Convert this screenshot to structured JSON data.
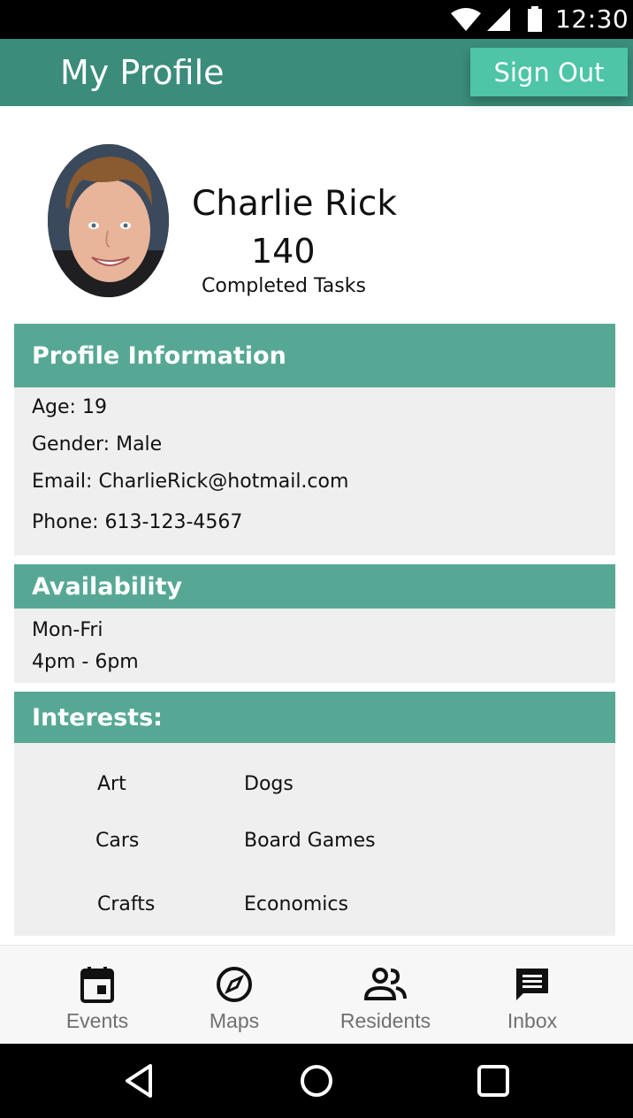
{
  "status_bar": {
    "time": "12:30",
    "icons": [
      "wifi-icon",
      "signal-icon",
      "battery-icon"
    ]
  },
  "header": {
    "title": "My Profile",
    "sign_out_label": "Sign Out"
  },
  "profile": {
    "name": "Charlie Rick",
    "completed_count": "140",
    "completed_label": "Completed Tasks"
  },
  "profile_info": {
    "title": "Profile Information",
    "age": "Age: 19",
    "gender": "Gender: Male",
    "email": "Email: CharlieRick@hotmail.com",
    "phone": "Phone: 613-123-4567"
  },
  "availability": {
    "title": "Availability",
    "days": "Mon-Fri",
    "hours": "4pm - 6pm"
  },
  "interests": {
    "title": "Interests:",
    "items": [
      "Art",
      "Dogs",
      "Cars",
      "Board Games",
      "Crafts",
      "Economics"
    ]
  },
  "bottom_nav": {
    "items": [
      {
        "label": "Events",
        "icon": "calendar-icon"
      },
      {
        "label": "Maps",
        "icon": "compass-icon"
      },
      {
        "label": "Residents",
        "icon": "people-icon"
      },
      {
        "label": "Inbox",
        "icon": "message-icon"
      }
    ]
  },
  "system_nav": {
    "icons": [
      "back-icon",
      "home-icon",
      "recents-icon"
    ]
  },
  "colors": {
    "app_bar": "#3b8c7a",
    "accent_button": "#4dc5a6",
    "section_header": "#56a894",
    "section_body": "#efefef"
  }
}
